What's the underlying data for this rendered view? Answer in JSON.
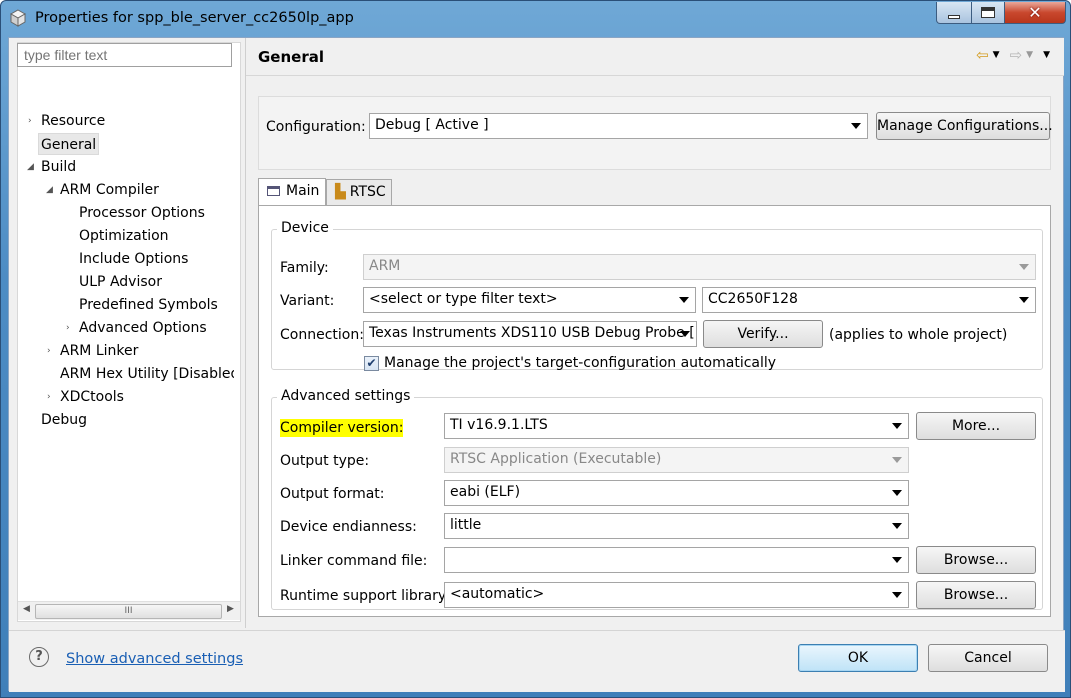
{
  "window": {
    "title": "Properties for spp_ble_server_cc2650lp_app"
  },
  "left": {
    "filter_placeholder": "type filter text",
    "tree": [
      {
        "label": "Resource"
      },
      {
        "label": "General"
      },
      {
        "label": "Build"
      },
      {
        "label": "ARM Compiler"
      },
      {
        "label": "Processor Options"
      },
      {
        "label": "Optimization"
      },
      {
        "label": "Include Options"
      },
      {
        "label": "ULP Advisor"
      },
      {
        "label": "Predefined Symbols"
      },
      {
        "label": "Advanced Options"
      },
      {
        "label": "ARM Linker"
      },
      {
        "label": "ARM Hex Utility  [Disabled]"
      },
      {
        "label": "XDCtools"
      },
      {
        "label": "Debug"
      }
    ],
    "scroll_thumb": "III"
  },
  "header": {
    "title": "General"
  },
  "config": {
    "label": "Configuration:",
    "value": "Debug  [ Active ]",
    "manage_button": "Manage Configurations..."
  },
  "tabs": [
    {
      "label": "Main"
    },
    {
      "label": "RTSC"
    }
  ],
  "device": {
    "group_title": "Device",
    "family_label": "Family:",
    "family_value": "ARM",
    "variant_label": "Variant:",
    "variant_filter": "<select or type filter text>",
    "variant_value": "CC2650F128",
    "connection_label": "Connection:",
    "connection_value": "Texas Instruments XDS110 USB Debug Probe [",
    "verify_button": "Verify...",
    "applies_note": "(applies to whole project)",
    "manage_checkbox": "Manage the project's target-configuration automatically"
  },
  "advanced": {
    "group_title": "Advanced settings",
    "compiler_label": "Compiler version:",
    "compiler_value": "TI v16.9.1.LTS",
    "more_button": "More...",
    "output_type_label": "Output type:",
    "output_type_value": "RTSC Application (Executable)",
    "output_format_label": "Output format:",
    "output_format_value": "eabi (ELF)",
    "endianness_label": "Device endianness:",
    "endianness_value": "little",
    "linker_label": "Linker command file:",
    "linker_value": "",
    "browse_button": "Browse...",
    "runtime_label": "Runtime support library:",
    "runtime_value": "<automatic>",
    "browse_button2": "Browse..."
  },
  "bottom": {
    "help_icon_glyph": "?",
    "advanced_link": "Show advanced settings",
    "ok": "OK",
    "cancel": "Cancel"
  },
  "colors": {
    "highlight": "#ffff00",
    "link": "#1a5fb4"
  }
}
